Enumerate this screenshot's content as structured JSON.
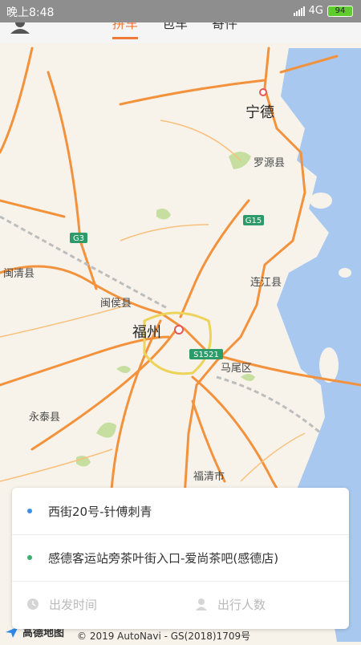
{
  "status_bar": {
    "time": "晚上8:48",
    "network": "4G",
    "battery": "94"
  },
  "tabs": [
    {
      "label": "拼车",
      "active": true
    },
    {
      "label": "包车",
      "active": false
    },
    {
      "label": "寄件",
      "active": false
    }
  ],
  "map": {
    "places": {
      "ningde": "宁德",
      "luoyuan": "罗源县",
      "minqing": "闽清县",
      "minhou": "闽侯县",
      "lianjiang": "连江县",
      "fuzhou": "福州",
      "mawei": "马尾区",
      "yongtai": "永泰县",
      "fuqing": "福清市"
    },
    "shields": {
      "g3": "G3",
      "g15": "G15",
      "s1521": "S1521"
    },
    "logo_text": "高德地图",
    "copyright": "© 2019 AutoNavi - GS(2018)1709号"
  },
  "trip": {
    "origin": "西街20号-针傅刺青",
    "destination": "感德客运站旁茶叶街入口-爱尚茶吧(感德店)",
    "departure_placeholder": "出发时间",
    "passengers_placeholder": "出行人数"
  },
  "colors": {
    "accent": "#f07a38",
    "road": "#f3923d",
    "sea": "#a8c8f0",
    "land": "#f7f3ea"
  }
}
